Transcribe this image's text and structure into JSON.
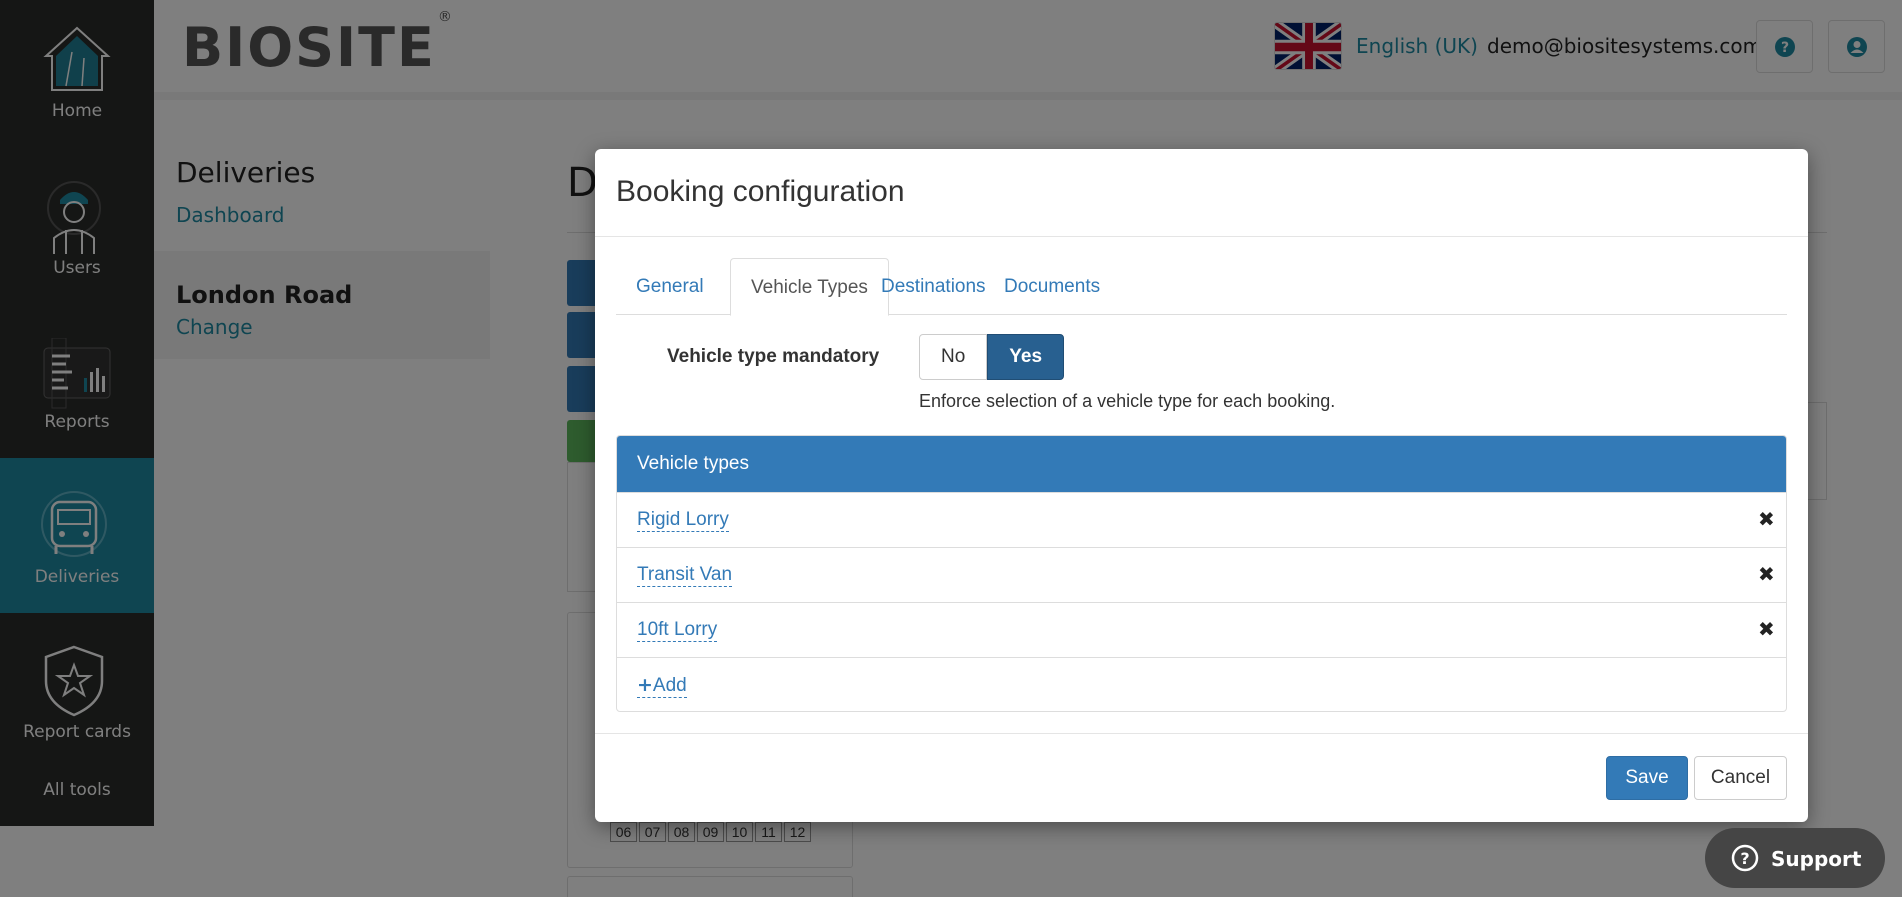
{
  "nav": {
    "home": "Home",
    "users": "Users",
    "reports": "Reports",
    "deliveries": "Deliveries",
    "report_cards": "Report cards",
    "all_tools": "All tools",
    "active_color": "#1f8aa2"
  },
  "header": {
    "logo": "BIOSITE",
    "logo_mark": "®",
    "language": "English (UK)",
    "email": "demo@biositesystems.com",
    "help_icon": "question-circle-icon",
    "account_icon": "user-circle-icon"
  },
  "sidebar": {
    "section_title": "Deliveries",
    "dashboard_link": "Dashboard",
    "site_name": "London Road",
    "change_link": "Change"
  },
  "background": {
    "title_initial": "D",
    "day_numbers": [
      "06",
      "07",
      "08",
      "09",
      "10",
      "11",
      "12"
    ]
  },
  "modal": {
    "title": "Booking configuration",
    "tabs": [
      {
        "label": "General",
        "active": false
      },
      {
        "label": "Vehicle Types",
        "active": true
      },
      {
        "label": "Destinations",
        "active": false
      },
      {
        "label": "Documents",
        "active": false
      }
    ],
    "mandatory_label": "Vehicle type mandatory",
    "toggle": {
      "no": "No",
      "yes": "Yes",
      "selected": "Yes"
    },
    "help_text": "Enforce selection of a vehicle type for each booking.",
    "panel_title": "Vehicle types",
    "vehicle_types": [
      "Rigid Lorry",
      "Transit Van",
      "10ft Lorry"
    ],
    "add_label": "Add",
    "save_label": "Save",
    "cancel_label": "Cancel",
    "accent_color": "#337ab7"
  },
  "support": {
    "label": "Support"
  }
}
